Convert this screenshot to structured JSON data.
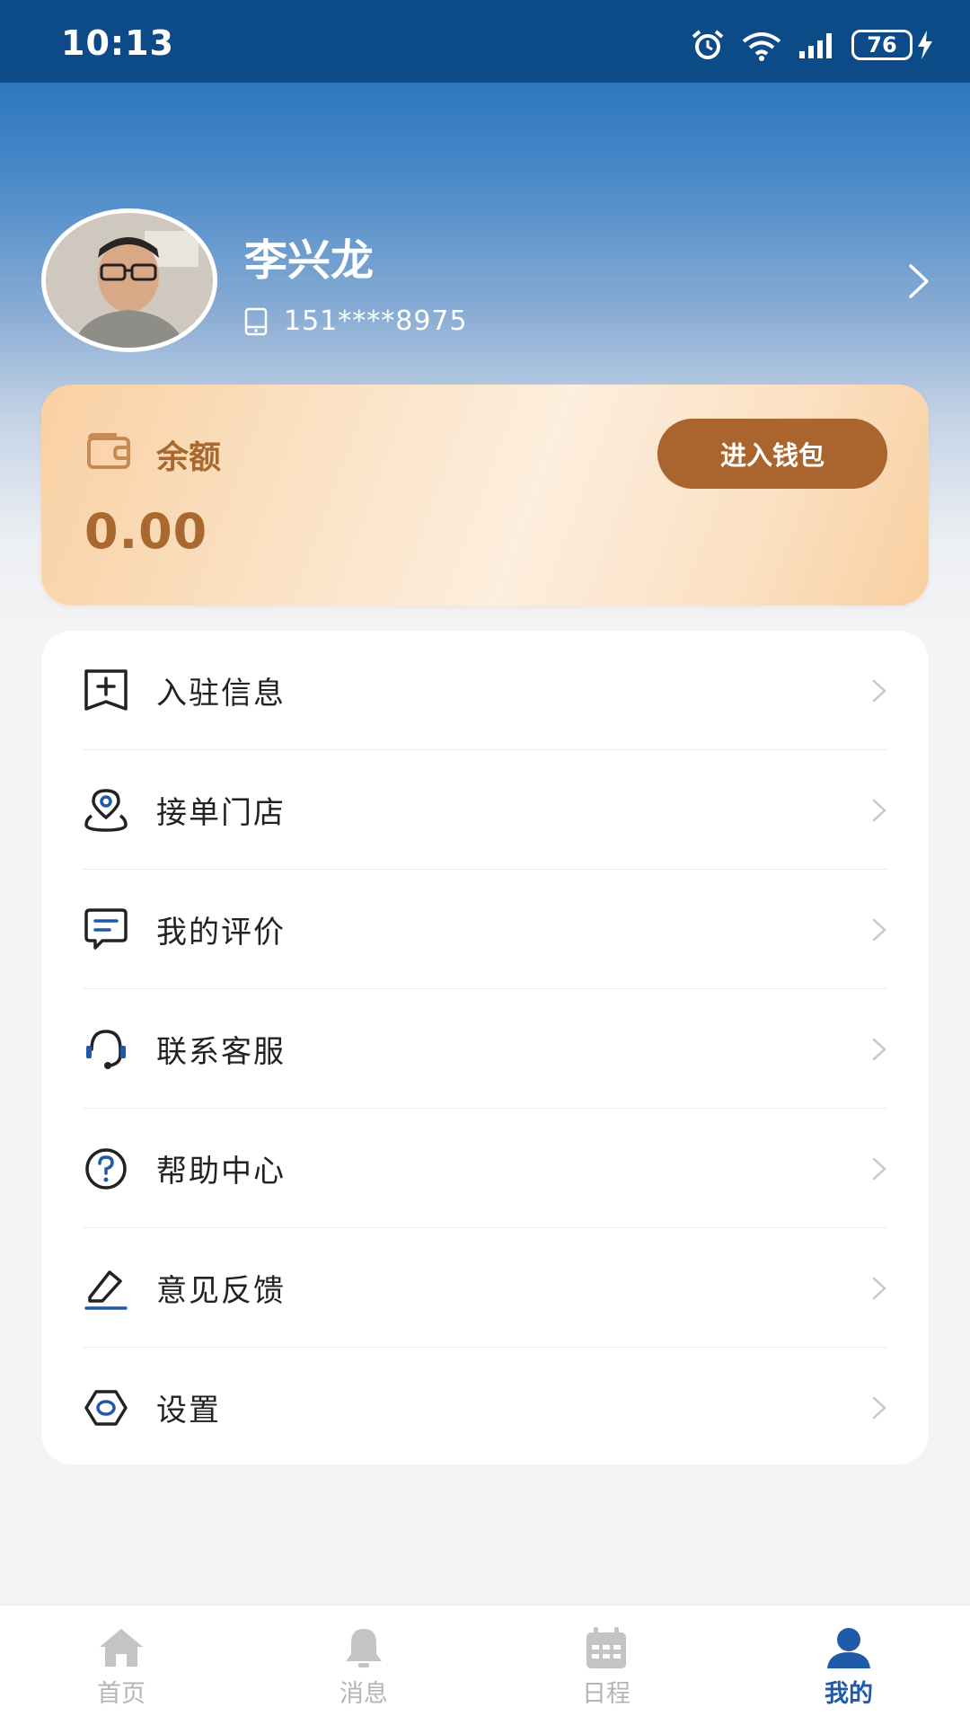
{
  "status_bar": {
    "time": "10:13",
    "battery": "76"
  },
  "profile": {
    "name": "李兴龙",
    "phone": "151****8975"
  },
  "wallet": {
    "label": "余额",
    "amount": "0.00",
    "button_label": "进入钱包",
    "accent_color": "#a9652d"
  },
  "menu": {
    "items": [
      {
        "label": "入驻信息",
        "icon": "add-bookmark-icon"
      },
      {
        "label": "接单门店",
        "icon": "location-pin-icon"
      },
      {
        "label": "我的评价",
        "icon": "chat-bubble-icon"
      },
      {
        "label": "联系客服",
        "icon": "headset-icon"
      },
      {
        "label": "帮助中心",
        "icon": "help-circle-icon"
      },
      {
        "label": "意见反馈",
        "icon": "edit-pen-icon"
      },
      {
        "label": "设置",
        "icon": "settings-hexagon-icon"
      }
    ]
  },
  "tab_bar": {
    "tabs": [
      {
        "label": "首页",
        "icon": "home-icon"
      },
      {
        "label": "消息",
        "icon": "bell-icon"
      },
      {
        "label": "日程",
        "icon": "calendar-icon"
      },
      {
        "label": "我的",
        "icon": "user-icon"
      }
    ],
    "active_index": 3,
    "active_color": "#1e5aa8"
  }
}
